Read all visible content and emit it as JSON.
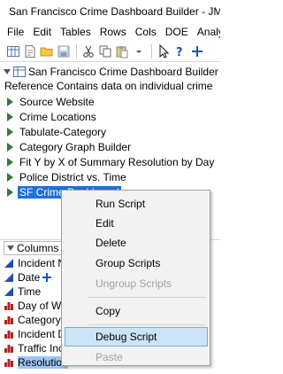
{
  "window": {
    "title": "San Francisco Crime Dashboard Builder - JMP"
  },
  "menubar": {
    "items": [
      "File",
      "Edit",
      "Tables",
      "Rows",
      "Cols",
      "DOE",
      "Analyze"
    ]
  },
  "toolbar": {
    "icons": [
      "new-table-icon",
      "new-script-icon",
      "open-icon",
      "save-icon",
      "cut-icon",
      "copy-icon",
      "paste-icon",
      "dropdown-arrow-icon",
      "arrow-cursor-icon",
      "help-cursor-icon",
      "selection-icon"
    ]
  },
  "tables_panel": {
    "title": "San Francisco Crime Dashboard Builder",
    "reference": "Reference  Contains data on individual crime",
    "scripts": [
      "Source Website",
      "Crime Locations",
      "Tabulate-Category",
      "Category Graph Builder",
      "Fit Y by X of Summary Resolution by Day",
      "Police District vs. Time",
      "SF Crime Dashboard"
    ]
  },
  "columns_panel": {
    "title": "Columns",
    "items": [
      {
        "label": "Incident N"
      },
      {
        "label": "Date"
      },
      {
        "label": "Time"
      },
      {
        "label": "Day of W"
      },
      {
        "label": "Category"
      },
      {
        "label": "Incident D"
      },
      {
        "label": "Traffic Inc"
      },
      {
        "label": "Resolution"
      }
    ]
  },
  "context_menu": {
    "items": [
      {
        "label": "Run Script",
        "enabled": true
      },
      {
        "label": "Edit",
        "enabled": true
      },
      {
        "label": "Delete",
        "enabled": true
      },
      {
        "label": "Group Scripts",
        "enabled": true
      },
      {
        "label": "Ungroup Scripts",
        "enabled": false
      },
      {
        "label": "Copy",
        "enabled": true
      },
      {
        "label": "Debug Script",
        "enabled": true,
        "highlighted": true
      },
      {
        "label": "Paste",
        "enabled": false
      }
    ]
  },
  "colors": {
    "selection": "#1e6fd9",
    "menu_highlight": "#cce4f7",
    "continuous_icon": "#1f4fb4",
    "nominal_icon": "#b22222",
    "script_play": "#2e7d32"
  }
}
